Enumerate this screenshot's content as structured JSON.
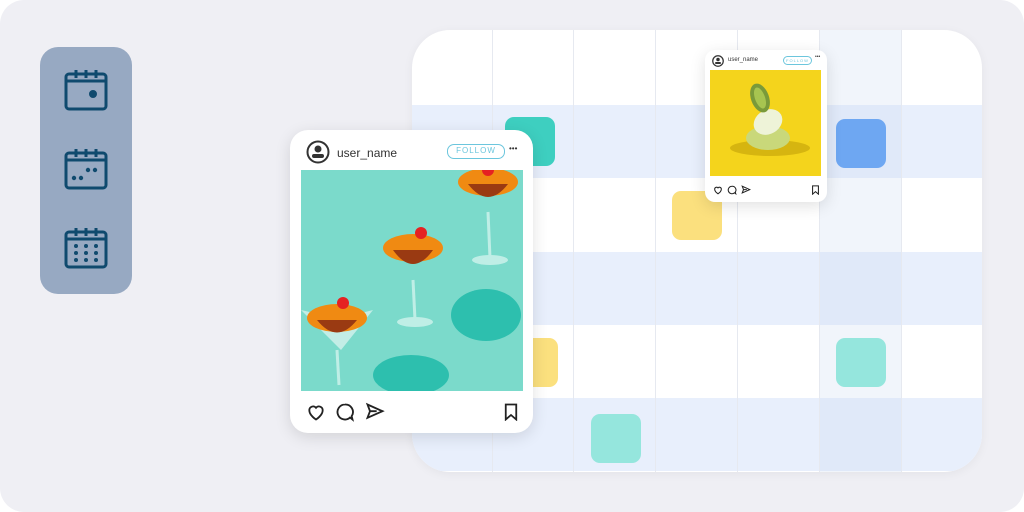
{
  "sidebar": {
    "items": [
      {
        "icon": "calendar-day-icon"
      },
      {
        "icon": "calendar-week-icon"
      },
      {
        "icon": "calendar-month-icon"
      }
    ]
  },
  "colors": {
    "teal": "#3ecfc0",
    "blue": "#6ea7f2",
    "yellow": "#fbe07e",
    "teal_light": "#95e6dd",
    "sidebar": "#97a9c2",
    "icon": "#0f4a6e"
  },
  "post_large": {
    "username": "user_name",
    "follow_label": "FOLLOW",
    "more": "•••"
  },
  "post_small": {
    "username": "user_name",
    "follow_label": "FOLLOW",
    "more": "•••"
  }
}
